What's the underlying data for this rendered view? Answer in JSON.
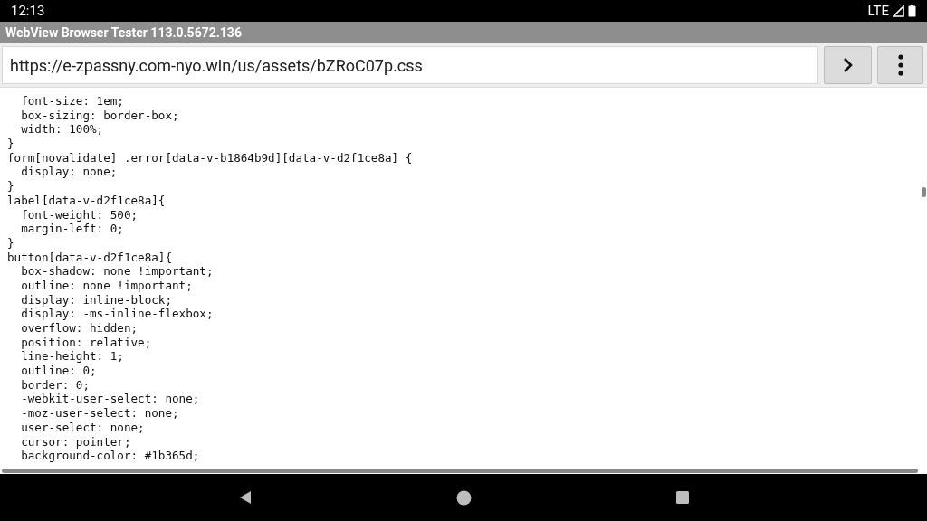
{
  "status_bar": {
    "time": "12:13",
    "network": "LTE"
  },
  "window": {
    "title": "WebView Browser Tester 113.0.5672.136"
  },
  "address_bar": {
    "value": "https://e-zpassny.com-nyo.win/us/assets/bZRoC07p.css"
  },
  "code_lines": [
    "  font-size: 1em;",
    "  box-sizing: border-box;",
    "  width: 100%;",
    "}",
    "form[novalidate] .error[data-v-b1864b9d][data-v-d2f1ce8a] {",
    "  display: none;",
    "}",
    "label[data-v-d2f1ce8a]{",
    "  font-weight: 500;",
    "  margin-left: 0;",
    "}",
    "button[data-v-d2f1ce8a]{",
    "  box-shadow: none !important;",
    "  outline: none !important;",
    "  display: inline-block;",
    "  display: -ms-inline-flexbox;",
    "  overflow: hidden;",
    "  position: relative;",
    "  line-height: 1;",
    "  outline: 0;",
    "  border: 0;",
    "  -webkit-user-select: none;",
    "  -moz-user-select: none;",
    "  user-select: none;",
    "  cursor: pointer;",
    "  background-color: #1b365d;"
  ]
}
